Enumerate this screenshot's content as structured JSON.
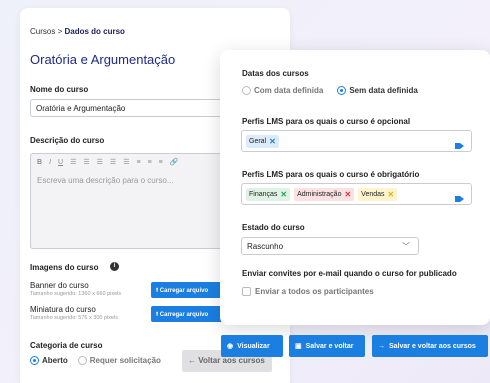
{
  "breadcrumb": {
    "root": "Cursos",
    "sep": " > ",
    "current": "Dados do curso"
  },
  "page_title": "Oratória e Argumentação",
  "course_name": {
    "label": "Nome do curso",
    "value": "Oratória e Argumentação"
  },
  "description": {
    "label": "Descrição do curso",
    "placeholder": "Escreva uma descrição para o curso...",
    "toolbar": [
      "B",
      "I",
      "U",
      "☰",
      "☰",
      "☰",
      "☰",
      "☰",
      "≡",
      "≡",
      "≡",
      "🔗"
    ]
  },
  "images": {
    "label": "Imagens do curso",
    "info": "i",
    "banner": {
      "label": "Banner do curso",
      "hint": "Tamanho sugerido: 1360 x 660 pixels",
      "button": "Carregar arquivo"
    },
    "thumb": {
      "label": "Miniatura do curso",
      "hint": "Tamanho sugerido: 576 x 300 pixels",
      "button": "Carregar arquivo"
    }
  },
  "category": {
    "label": "Categoria de curso",
    "options": [
      "Aberto",
      "Requer solicitação"
    ],
    "selected": "Aberto"
  },
  "back_button": "Voltar aos cursos",
  "panel": {
    "dates": {
      "label": "Datas dos cursos",
      "options": [
        "Com data definida",
        "Sem data definida"
      ],
      "selected": "Sem data definida"
    },
    "optional": {
      "label": "Perfis LMS para os quais o curso é opcional",
      "tags": [
        {
          "text": "Geral",
          "color": "#dcebfb",
          "xcolor": "#1a7fe0"
        }
      ]
    },
    "required": {
      "label": "Perfis LMS para os quais o curso é obrigatório",
      "tags": [
        {
          "text": "Finanças",
          "color": "#dff3e5",
          "xcolor": "#2aa05a"
        },
        {
          "text": "Administração",
          "color": "#fbe1e1",
          "xcolor": "#d9364a"
        },
        {
          "text": "Vendas",
          "color": "#fff4cc",
          "xcolor": "#e0b020"
        }
      ]
    },
    "state": {
      "label": "Estado do curso",
      "value": "Rascunho"
    },
    "invites": {
      "label": "Enviar convites por e-mail quando o curso for publicado",
      "checkbox": "Enviar a todos os participantes"
    }
  },
  "actions": {
    "view": "Visualizar",
    "save_back": "Salvar e voltar",
    "save_back_courses": "Salvar e voltar aos cursos"
  },
  "colors": {
    "accent": "#1a7fe0",
    "title": "#1f2a8a"
  }
}
